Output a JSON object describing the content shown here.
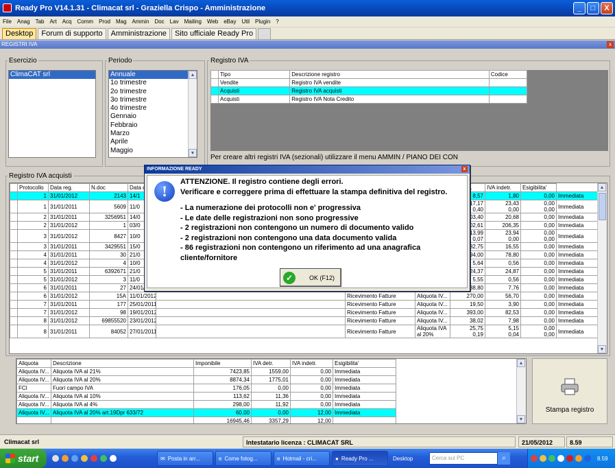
{
  "window": {
    "title": "Ready Pro V14.1.31 - Climacat srl - Graziella Crispo - Amministrazione",
    "btn_min": "_",
    "btn_max": "□",
    "btn_close": "X"
  },
  "menu": [
    "File",
    "Anag",
    "Tab",
    "Art",
    "Acq",
    "Comm",
    "Prod",
    "Mag",
    "Ammin",
    "Doc",
    "Lav",
    "Mailing",
    "Web",
    "eBay",
    "Util",
    "Plugin",
    "?"
  ],
  "tabs": [
    {
      "label": "Desktop",
      "state": "active"
    },
    {
      "label": "Forum di supporto",
      "state": "normal"
    },
    {
      "label": "Amministrazione",
      "state": "normal"
    },
    {
      "label": "Sito ufficiale Ready Pro",
      "state": "normal"
    },
    {
      "label": "...",
      "state": "disabled"
    }
  ],
  "panel": {
    "title": "REGISTRI IVA",
    "close": "x"
  },
  "esercizio": {
    "legend": "Esercizio",
    "items": [
      "ClimaCAT srl"
    ]
  },
  "periodo": {
    "legend": "Periodo",
    "items": [
      "Annuale",
      "1o trimestre",
      "2o trimestre",
      "3o trimestre",
      "4o trimestre",
      "Gennaio",
      "Febbraio",
      "Marzo",
      "Aprile",
      "Maggio"
    ]
  },
  "registro": {
    "legend": "Registro IVA",
    "headers": [
      "Tipo",
      "Descrizione registro",
      "Codice"
    ],
    "rows": [
      [
        "Vendite",
        "Registro IVA vendite",
        ""
      ],
      [
        "Acquisti",
        "Registro IVA acquisti",
        ""
      ],
      [
        "Acquisti",
        "Registro IVA Nota Credito",
        ""
      ]
    ],
    "hint": "Per creare altri registri IVA (sezionali) utilizzare il menu AMMIN / PIANO DEI CON"
  },
  "acquisti": {
    "legend": "Registro IVA acquisti",
    "headers_left": [
      "Protocollo",
      "Data reg.",
      "N.doc",
      "Data d"
    ],
    "headers_right": [
      "ibile",
      "IVA detr.",
      "IVA indetr.",
      "Esigibilita'"
    ],
    "rows": [
      [
        "1",
        "31/01/2012",
        "2143",
        "14/1",
        "",
        "",
        "",
        "8,57",
        "1,80",
        "0,00",
        "Immediata"
      ],
      [
        "1",
        "31/01/2011",
        "5609",
        "11/0",
        "",
        "",
        "",
        "17,17\n0,40",
        "23,43\n0,00",
        "0,00\n0,00",
        "Immediata"
      ],
      [
        "2",
        "31/01/2011",
        "3256951",
        "14/0",
        "",
        "",
        "",
        "03,40",
        "20,68",
        "0,00",
        "Immediata"
      ],
      [
        "2",
        "31/01/2012",
        "1",
        "03/0",
        "",
        "",
        "",
        "02,61",
        "206,35",
        "0,00",
        "Immediata"
      ],
      [
        "3",
        "31/01/2012",
        "8427",
        "10/0",
        "",
        "",
        "",
        "13,99\n0,07",
        "23,94\n0,00",
        "0,00\n0,00",
        "Immediata"
      ],
      [
        "3",
        "31/01/2011",
        "3429551",
        "15/0",
        "",
        "",
        "",
        "82,75",
        "16,55",
        "0,00",
        "Immediata"
      ],
      [
        "4",
        "31/01/2011",
        "30",
        "21/0",
        "",
        "",
        "",
        "94,00",
        "78,80",
        "0,00",
        "Immediata"
      ],
      [
        "4",
        "31/01/2012",
        "4",
        "10/0",
        "",
        "",
        "",
        "5,64",
        "0,56",
        "0,00",
        "Immediata"
      ],
      [
        "5",
        "31/01/2011",
        "6392671",
        "21/0",
        "",
        "",
        "",
        "24,37",
        "24,87",
        "0,00",
        "Immediata"
      ],
      [
        "5",
        "31/01/2012",
        "3",
        "11/0",
        "",
        "",
        "",
        "5,55",
        "0,56",
        "0,00",
        "Immediata"
      ],
      [
        "6",
        "31/01/2011",
        "27",
        "24/01/2011",
        "",
        "Ricevimento Fatture",
        "Aliquota IV...",
        "38,80",
        "7,76",
        "0,00",
        "Immediata"
      ],
      [
        "6",
        "31/01/2012",
        "15A",
        "11/01/2012",
        "",
        "Ricevimento Fatture",
        "Aliquota IV...",
        "270,00",
        "56,70",
        "0,00",
        "Immediata"
      ],
      [
        "7",
        "31/01/2011",
        "177",
        "25/01/2011",
        "",
        "Ricevimento Fatture",
        "Aliquota IV...",
        "19,50",
        "3,90",
        "0,00",
        "Immediata"
      ],
      [
        "7",
        "31/01/2012",
        "98",
        "19/01/2012",
        "",
        "Ricevimento Fatture",
        "Aliquota IV...",
        "393,00",
        "82,53",
        "0,00",
        "Immediata"
      ],
      [
        "8",
        "31/01/2012",
        "69855520",
        "23/01/2012",
        "",
        "Ricevimento Fatture",
        "Aliquota IV...",
        "38,02",
        "7,98",
        "0,00",
        "Immediata"
      ],
      [
        "8",
        "31/01/2011",
        "84052",
        "27/01/2011",
        "",
        "Ricevimento Fatture",
        "Aliquota IVA\nal 20%",
        "25,75\n0,19",
        "5,15\n0,04",
        "0,00\n0,00",
        "Immediata"
      ]
    ]
  },
  "riepilogo": {
    "headers": [
      "Aliquota",
      "Descrizione",
      "Imponibile",
      "IVA detr.",
      "IVA indetr.",
      "Esigibilita'"
    ],
    "rows": [
      [
        "Aliquota IV...",
        "Aliquota IVA al 21%",
        "7423,85",
        "1559,00",
        "0,00",
        "Immediata"
      ],
      [
        "Aliquota IV...",
        "Aliquota IVA al 20%",
        "8874,34",
        "1775,01",
        "0,00",
        "Immediata"
      ],
      [
        "FCI",
        "Fuori campo IVA",
        "176,05",
        "0,00",
        "0,00",
        "Immediata"
      ],
      [
        "Aliquota IV...",
        "Aliquota IVA al 10%",
        "113,62",
        "11,36",
        "0,00",
        "Immediata"
      ],
      [
        "Aliquota IV...",
        "Aliquota IVA al 4%",
        "298,00",
        "11,92",
        "0,00",
        "Immediata"
      ],
      [
        "Aliquota IV...",
        "Aliquota IVA al 20% art.19Dpr 633/72",
        "60,00",
        "0,00",
        "12,00",
        "Immediata"
      ]
    ],
    "total": [
      "",
      "",
      "16945,46",
      "3357,29",
      "12,00",
      ""
    ]
  },
  "print_button": "Stampa registro",
  "dialog": {
    "title": "INFORMAZIONE READY",
    "close": "x",
    "icon": "!",
    "lines": [
      "ATTENZIONE. Il registro contiene degli errori.",
      "Verificare e correggere prima di effettuare la stampa definitiva del registro.",
      "",
      "- La numerazione dei protocolli non e' progressiva",
      "- Le date delle registrazioni non sono progressive",
      "- 2 registrazioni non contengono un numero di documento valido",
      "- 2 registrazioni non contengono una data documento valida",
      "- 86 registrazioni non contengono un riferimento ad una anagrafica",
      "cliente/fornitore"
    ],
    "ok_label": "OK (F12)",
    "ok_icon": "✓"
  },
  "status": {
    "company": "Climacat srl",
    "license": "Intestatario licenza : CLIMACAT SRL",
    "date": "21/05/2012",
    "time": "8.59"
  },
  "taskbar": {
    "start": "start",
    "buttons": [
      "Posta in arr...",
      "Come fotog...",
      "Hotmail - cri...",
      "Ready Pro ...",
      "Desktop"
    ],
    "search_placeholder": "Cerca sul PC",
    "clock": "8.59"
  }
}
